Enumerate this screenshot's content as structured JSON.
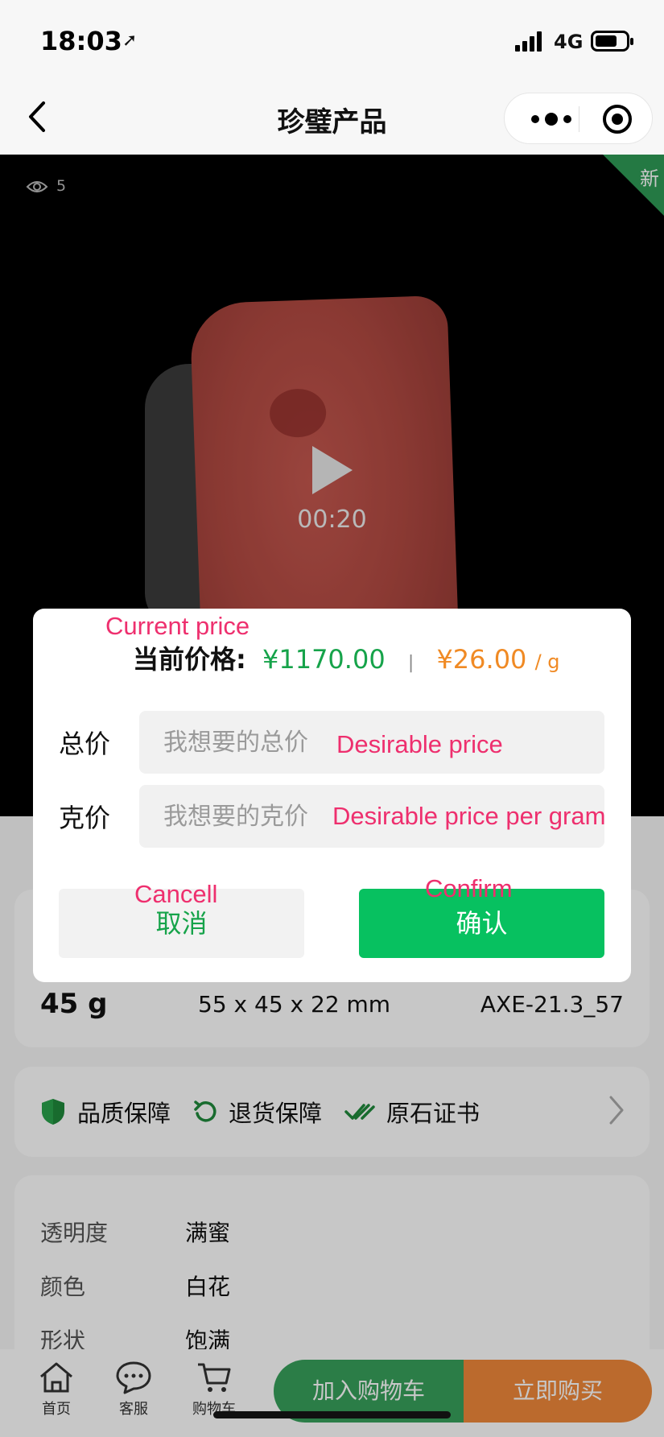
{
  "status_bar": {
    "time": "18:03",
    "network": "4G"
  },
  "nav": {
    "title": "珍璧产品"
  },
  "video": {
    "views": "5",
    "badge": "新",
    "duration": "00:20"
  },
  "modal": {
    "price_label": "当前价格:",
    "total_price": "¥1170.00",
    "separator": "|",
    "unit_price": "¥26.00",
    "unit_suffix": "/ g",
    "total_label": "总价",
    "total_placeholder": "我想要的总价",
    "gram_label": "克价",
    "gram_placeholder": "我想要的克价",
    "cancel_label": "取消",
    "confirm_label": "确认"
  },
  "annotations": {
    "current_price": "Current price",
    "desirable_price": "Desirable price",
    "desirable_per_gram": "Desirable price per gram",
    "cancel": "Cancell",
    "confirm": "Confirm"
  },
  "specs": {
    "weight": "45 g",
    "dimensions": "55 x 45 x 22 mm",
    "code": "AXE-21.3_57"
  },
  "guarantees": [
    {
      "label": "品质保障",
      "icon": "shield-icon"
    },
    {
      "label": "退货保障",
      "icon": "return-icon"
    },
    {
      "label": "原石证书",
      "icon": "double-check-icon"
    }
  ],
  "attributes": [
    {
      "key": "透明度",
      "value": "满蜜"
    },
    {
      "key": "颜色",
      "value": "白花"
    },
    {
      "key": "形状",
      "value": "饱满"
    }
  ],
  "bottom_bar": {
    "tabs": [
      {
        "label": "首页",
        "icon": "home-icon"
      },
      {
        "label": "客服",
        "icon": "chat-icon"
      },
      {
        "label": "购物车",
        "icon": "cart-icon"
      }
    ],
    "add_to_cart": "加入购物车",
    "buy_now": "立即购买"
  },
  "colors": {
    "accent_green": "#07c160",
    "price_orange": "#f08a24",
    "annotation_pink": "#ee2f6e",
    "cart_green": "#38a05b",
    "buy_orange": "#f0883a"
  }
}
